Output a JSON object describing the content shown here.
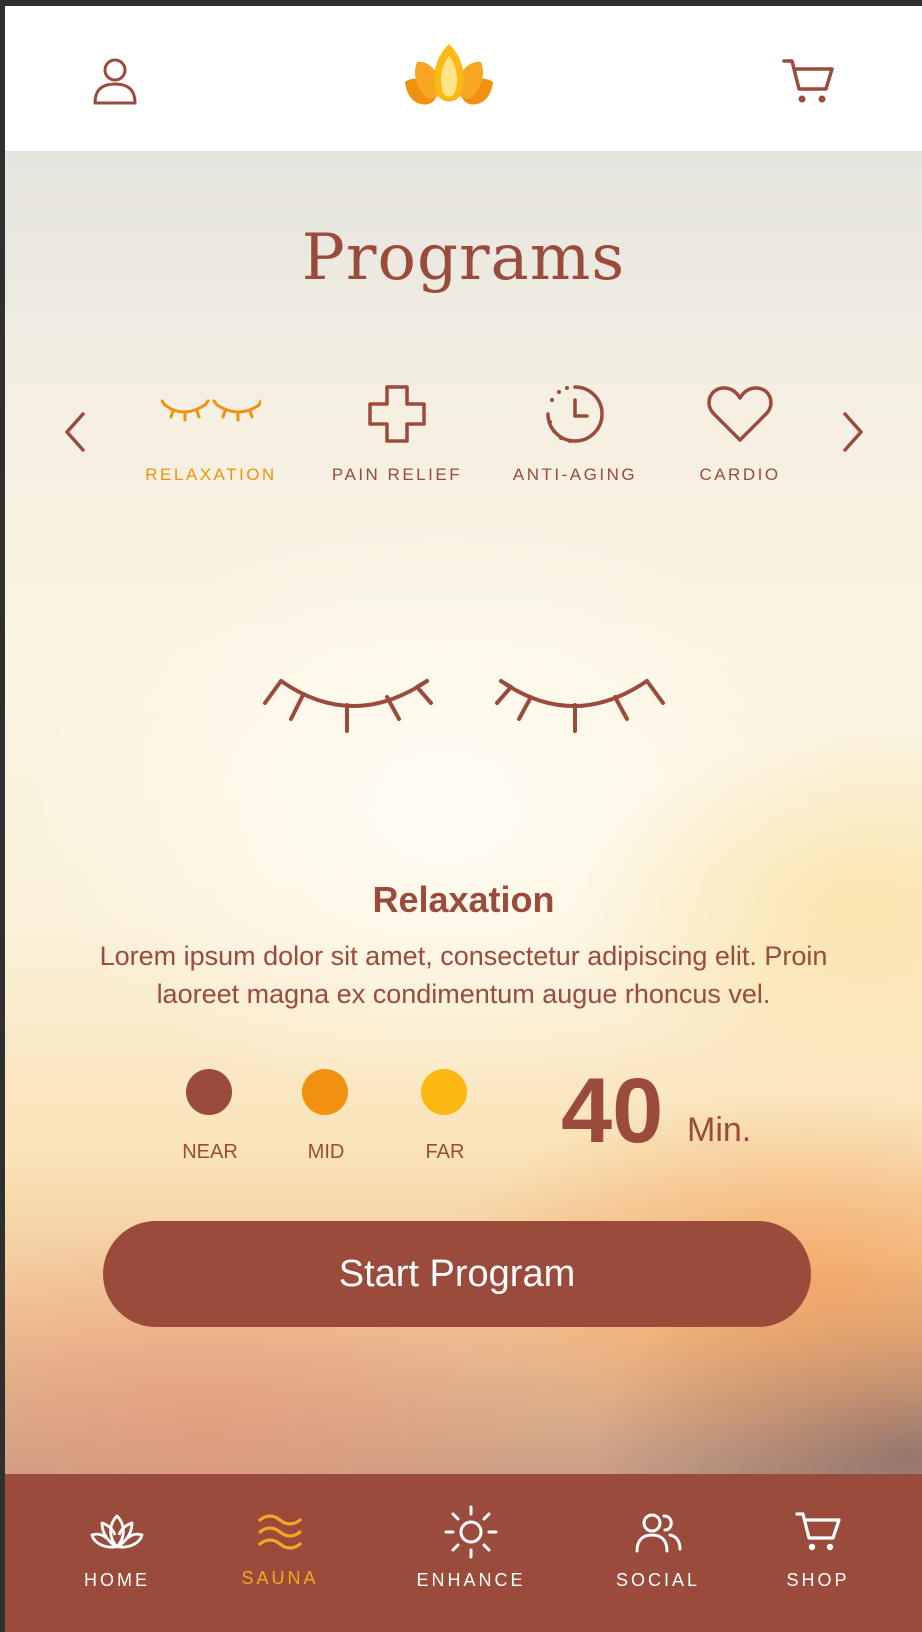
{
  "header": {
    "profile_icon": "user-icon",
    "logo_icon": "lotus-logo",
    "cart_icon": "cart-icon"
  },
  "programs": {
    "title": "Programs",
    "categories": [
      {
        "label": "RELAXATION",
        "icon": "closed-eyes-icon",
        "active": true
      },
      {
        "label": "PAIN RELIEF",
        "icon": "medical-cross-icon",
        "active": false
      },
      {
        "label": "ANTI-AGING",
        "icon": "clock-history-icon",
        "active": false
      },
      {
        "label": "CARDIO",
        "icon": "heart-icon",
        "active": false
      }
    ],
    "prev_icon": "chevron-left-icon",
    "next_icon": "chevron-right-icon"
  },
  "selected": {
    "icon": "closed-eyes-icon",
    "name": "Relaxation",
    "description": "Lorem ipsum dolor sit amet, consectetur adipiscing elit. Proin laoreet magna ex condimentum augue rhoncus vel.",
    "zones": [
      {
        "label": "NEAR",
        "color": "#9b4b3b"
      },
      {
        "label": "MID",
        "color": "#f0920f"
      },
      {
        "label": "FAR",
        "color": "#fbb911"
      }
    ],
    "duration_value": "40",
    "duration_unit": "Min.",
    "start_label": "Start Program"
  },
  "nav": {
    "items": [
      {
        "label": "HOME",
        "icon": "lotus-icon",
        "active": false
      },
      {
        "label": "SAUNA",
        "icon": "waves-icon",
        "active": true
      },
      {
        "label": "ENHANCE",
        "icon": "sun-icon",
        "active": false
      },
      {
        "label": "SOCIAL",
        "icon": "users-icon",
        "active": false
      },
      {
        "label": "SHOP",
        "icon": "cart-icon",
        "active": false
      }
    ]
  },
  "colors": {
    "primary": "#9b4b3b",
    "accent": "#f0920f",
    "accent_light": "#fbb911"
  }
}
